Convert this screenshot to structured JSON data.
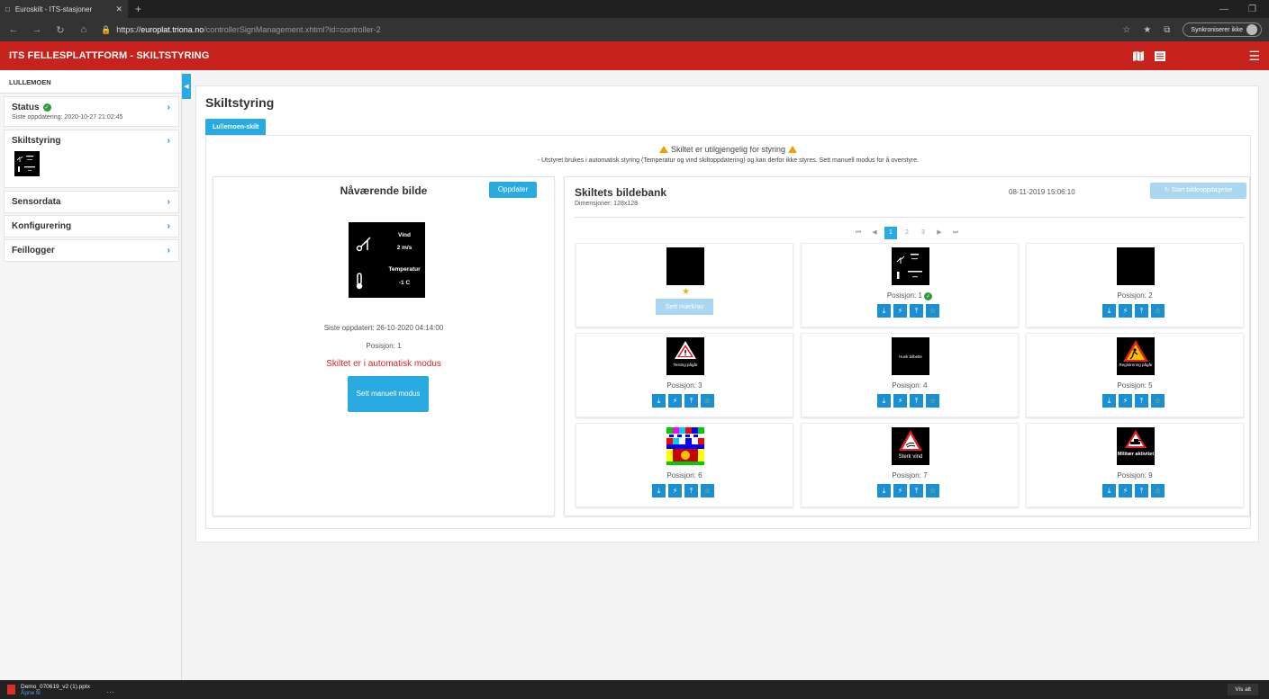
{
  "browser": {
    "tab_title": "Euroskilt - ITS-stasjoner",
    "url_scheme": "https://",
    "url_host": "europlat.triona.no",
    "url_path": "/controllerSignManagement.xhtml?id=controller-2",
    "sync_label": "Synkroniserer ikke"
  },
  "app": {
    "title": "ITS FELLESPLATTFORM - SKILTSTYRING"
  },
  "sidebar": {
    "header": "LULLEMOEN",
    "items": [
      {
        "label": "Status",
        "sub": "Siste oppdatering: 2020-10-27 21:02:45"
      },
      {
        "label": "Skiltstyring"
      },
      {
        "label": "Sensordata"
      },
      {
        "label": "Konfigurering"
      },
      {
        "label": "Feillogger"
      }
    ]
  },
  "main": {
    "page_title": "Skiltstyring",
    "tab_label": "Lullemoen-skilt",
    "warning_title": "Skiltet er utilgjengelig for styring",
    "warning_sub": "- Utstyret brukes i automatisk styring (Temperatur og vind skiltoppdatering) og kan derfor ikke styres. Sett manuell modus for å overstyre."
  },
  "current": {
    "title": "Nåværende bilde",
    "refresh_label": "Oppdater",
    "sign_wind_label": "Vind",
    "sign_wind_value": "2 m/s",
    "sign_temp_label": "Temperatur",
    "sign_temp_value": "-1 C",
    "last_updated": "Siste oppdatert: 26-10-2020 04:14:00",
    "position": "Posisjon: 1",
    "mode_text": "Skiltet er i automatisk modus",
    "manual_btn": "Sett manuell modus"
  },
  "bank": {
    "title": "Skiltets bildebank",
    "dimensions": "Dimensjoner: 128x128",
    "date": "08-11-2019 15:06:10",
    "start_btn": "Start bildeoppdagelse",
    "pages": [
      "1",
      "2",
      "3"
    ],
    "active_page": "1",
    "dark_btn": "Sett mørk/av",
    "cells": [
      {
        "position": ""
      },
      {
        "position": "Posisjon: 1"
      },
      {
        "position": "Posisjon: 2"
      },
      {
        "position": "Posisjon: 3",
        "thumb_text": "Testing pågår"
      },
      {
        "position": "Posisjon: 4",
        "thumb_text": "Husk bilbelte"
      },
      {
        "position": "Posisjon: 5",
        "thumb_text": "Registrering pågår"
      },
      {
        "position": "Posisjon: 6"
      },
      {
        "position": "Posisjon: 7",
        "thumb_text": "Sterk vind"
      },
      {
        "position": "Posisjon: 9",
        "thumb_text": "Militær aktivitet"
      }
    ]
  },
  "downloads": {
    "file_name": "Demo_070619_v2 (1).pptx",
    "open_label": "Åpne fil",
    "show_all": "Vis alt"
  },
  "colors": {
    "header_red": "#c8221d",
    "accent_blue": "#29aae1",
    "action_blue": "#1a8fd1",
    "warning_orange": "#f0a000",
    "ok_green": "#2e9b3e",
    "mode_red": "#e02020"
  }
}
